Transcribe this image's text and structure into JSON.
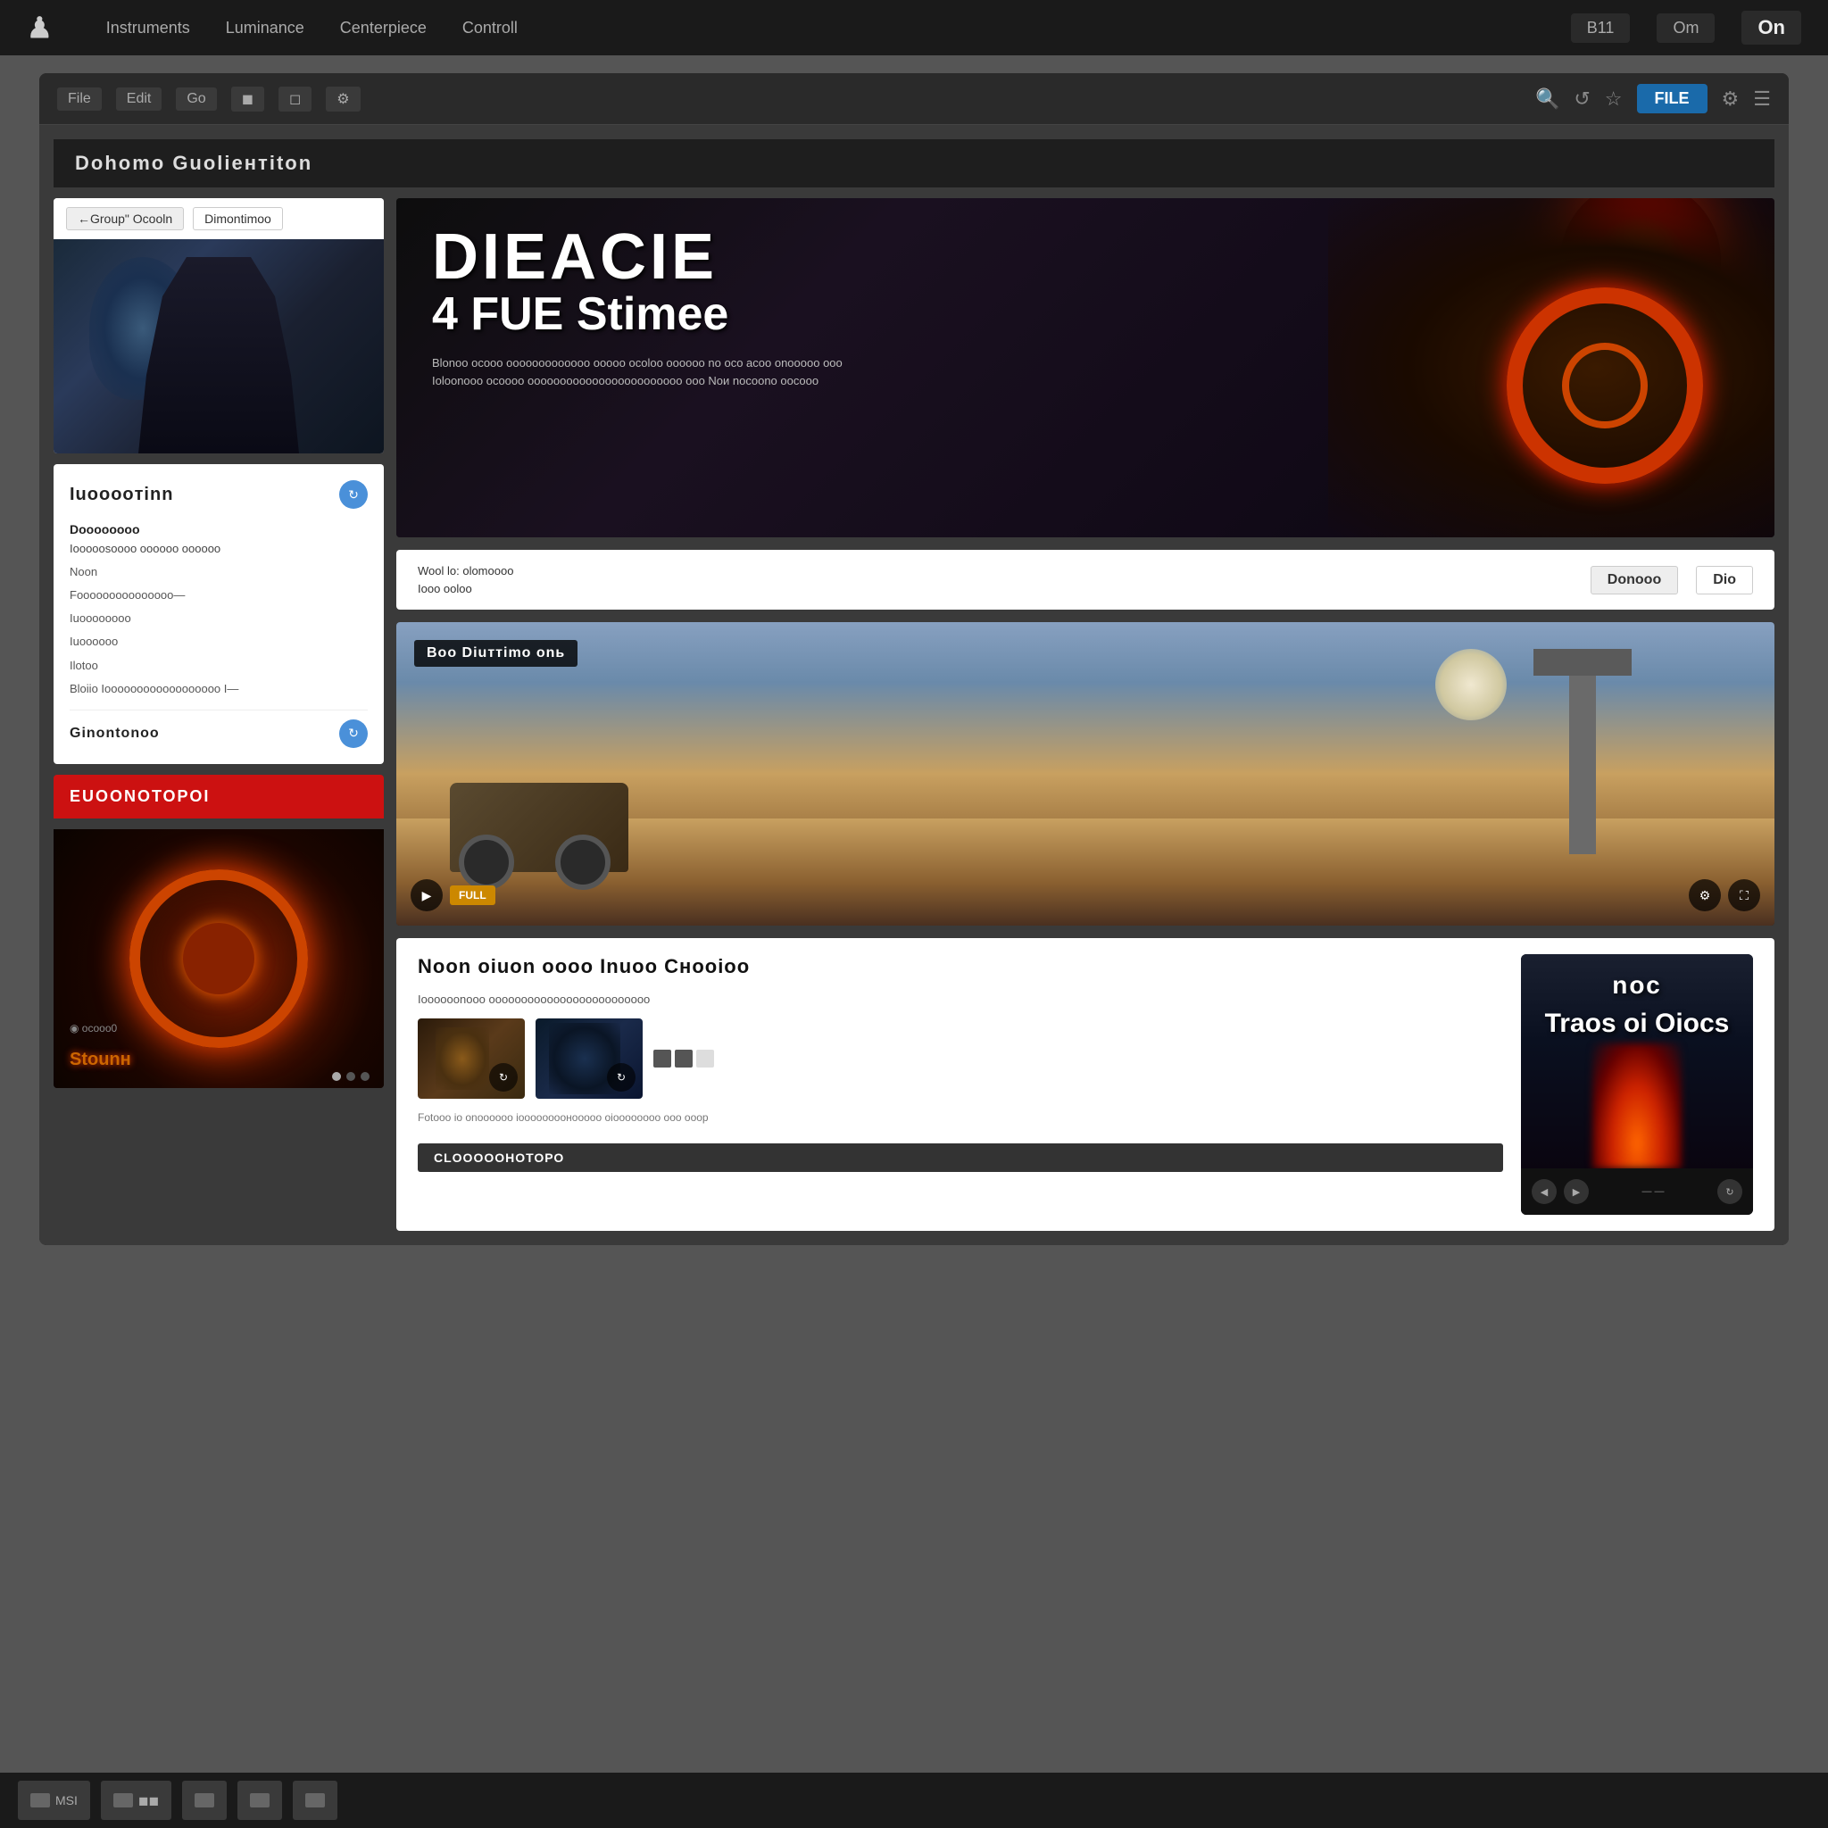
{
  "topnav": {
    "logo": "♟",
    "items": [
      "Instruments",
      "Luminance",
      "Centerpiece",
      "Controll"
    ],
    "right_items": [
      "B11",
      "Om",
      "On"
    ],
    "on_label": "On"
  },
  "browser": {
    "toolbar": {
      "left_items": [
        "File",
        "Edit",
        "Go",
        "◼",
        "◻",
        "⚙"
      ],
      "search_label": "FILE",
      "right_icons": [
        "🔍",
        "↺",
        "☆",
        "⚙"
      ]
    },
    "page_title": "Dohomо Guoliентitоn",
    "hero_left": {
      "tab1": "←Group\" Ocooln",
      "tab2": "Dimontimoo"
    },
    "info_panel": {
      "title": "Iuooooтinn",
      "rows": [
        {
          "label": "Dоооооооо",
          "value": "Iooooosoooo oooooo oooooo"
        },
        {
          "label": "Noon"
        },
        {
          "label": "Fooooooooooooooo—"
        },
        {
          "label": "Iuooooooоo"
        },
        {
          "label": "Iuоooоoo"
        },
        {
          "label": "Ilotoo"
        },
        {
          "label": "Вlоiio Ioooooooooooooоoooo  I—"
        }
      ],
      "footer_label": "Ginontonoo"
    },
    "red_banner": {
      "label": "EUOONOТОРОI"
    },
    "hero_right": {
      "title": "DIEACIE",
      "subtitle": "4 FUE Stimee",
      "description": "Blоnoо ocооо oоooooоoоoooo oоooo ocoloo oooooo nо оcо аcoо onooооо оoo\nIoloonooo ocoooo oоoоoooooooooooooooooooo оoо\nNои nоcoоno oоcooо"
    },
    "info_strip": {
      "left_line1": "Wool lo: olomоooo",
      "left_line2": "Iooo ooloo",
      "btn1": "Donooo",
      "btn2": "Dio"
    },
    "video": {
      "label": "Boo Diuттimo оnь",
      "controls": {
        "play": "▶",
        "tag": "FULL",
        "settings": "⚙",
        "fullscreen": "⛶"
      }
    },
    "bottom_section": {
      "title": "Noon оiuon оooo\nInuoo Снoоioo",
      "desc": "Ioоoooonooo оooоoооoooooоoooooooooooo",
      "footer_text": "Fotooo io onoooooo iooooooooнoооoo\noioooooooo oоo ooop",
      "cta": "CLОООООНОТОРО"
    },
    "promo_card": {
      "title": "Trаоs\nоi\nОiоcs",
      "label": "nос"
    }
  },
  "taskbar": {
    "items": [
      "MSI",
      "◼◼",
      "—",
      "████",
      "◼"
    ]
  }
}
